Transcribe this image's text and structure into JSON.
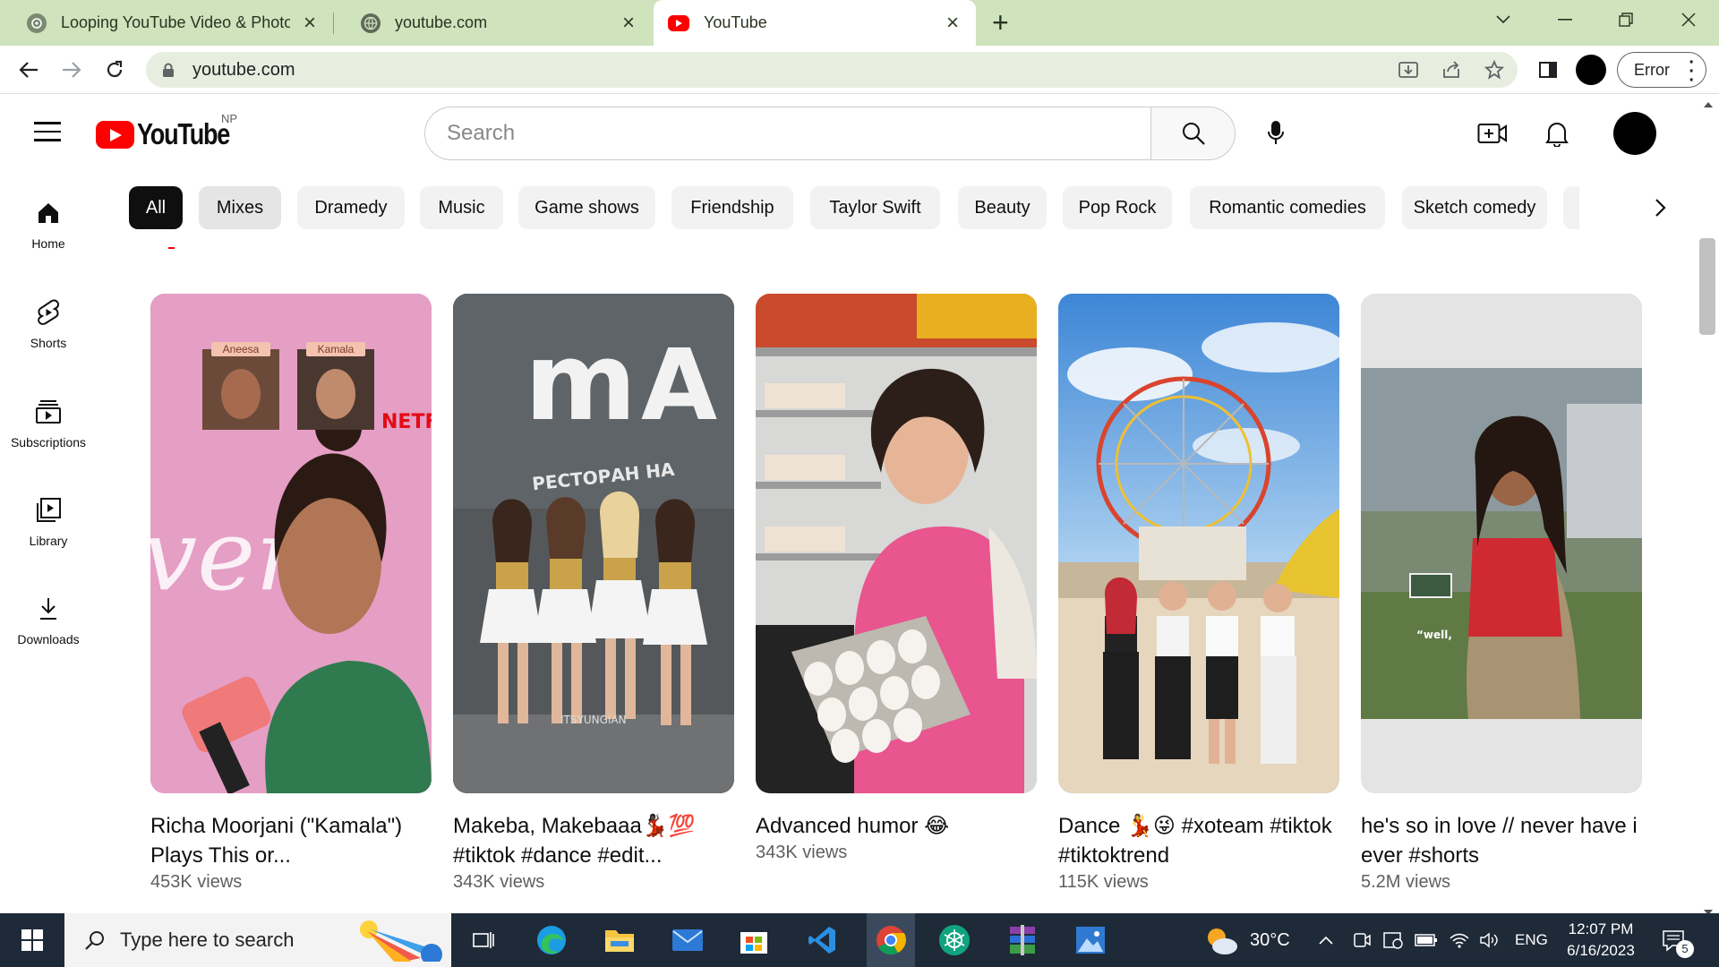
{
  "browser": {
    "tabs": [
      {
        "title": "Looping YouTube Video & Photo",
        "icon": "chatgpt-icon",
        "active": false
      },
      {
        "title": "youtube.com",
        "icon": "globe-icon",
        "active": false
      },
      {
        "title": "YouTube",
        "icon": "youtube-icon",
        "active": true
      }
    ],
    "url": "youtube.com",
    "profile_button_label": "Error"
  },
  "youtube": {
    "logo_text": "YouTube",
    "country_code": "NP",
    "search_placeholder": "Search",
    "sidebar": [
      {
        "label": "Home",
        "icon": "home-icon"
      },
      {
        "label": "Shorts",
        "icon": "shorts-icon"
      },
      {
        "label": "Subscriptions",
        "icon": "subscriptions-icon"
      },
      {
        "label": "Library",
        "icon": "library-icon"
      },
      {
        "label": "Downloads",
        "icon": "download-icon"
      }
    ],
    "chips": [
      "All",
      "Mixes",
      "Dramedy",
      "Music",
      "Game shows",
      "Friendship",
      "Taylor Swift",
      "Beauty",
      "Pop Rock",
      "Romantic comedies",
      "Sketch comedy",
      "D"
    ],
    "videos": [
      {
        "title": "Richa Moorjani (\"Kamala\") Plays This or...",
        "views": "453K views",
        "overlay_labels": [
          "Aneesa",
          "Kamala"
        ]
      },
      {
        "title": "Makeba, Makebaaa💃🏿💯 #tiktok #dance #edit...",
        "views": "343K views",
        "overlay_labels": []
      },
      {
        "title": "Advanced humor 😂",
        "views": "343K views",
        "overlay_labels": []
      },
      {
        "title": "Dance 💃😜 #xoteam #tiktok #tiktoktrend",
        "views": "115K views",
        "overlay_labels": []
      },
      {
        "title": "he's so in love // never have i ever #shorts",
        "views": "5.2M views",
        "overlay_labels": []
      }
    ]
  },
  "taskbar": {
    "search_placeholder": "Type here to search",
    "weather": "30°C",
    "language": "ENG",
    "time": "12:07 PM",
    "date": "6/16/2023",
    "notification_count": "5"
  }
}
